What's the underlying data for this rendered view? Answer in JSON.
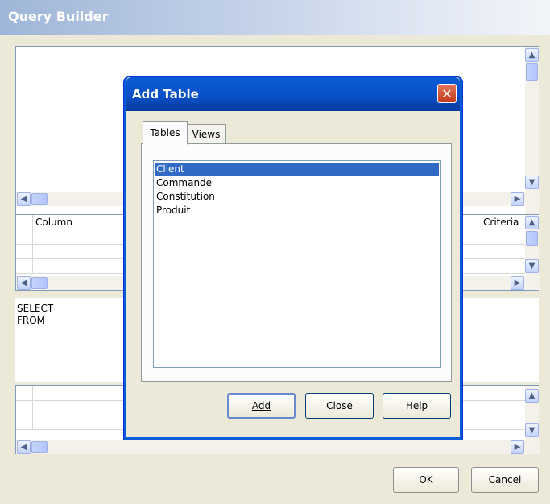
{
  "window": {
    "title": "Query Builder"
  },
  "grid": {
    "column_header": "Column",
    "criteria_header": "Criteria"
  },
  "sql": {
    "lines": [
      "SELECT",
      "FROM"
    ]
  },
  "footer": {
    "ok_label": "OK",
    "cancel_label": "Cancel"
  },
  "dialog": {
    "title": "Add Table",
    "tabs": [
      {
        "label": "Tables",
        "active": true
      },
      {
        "label": "Views",
        "active": false
      }
    ],
    "tables": [
      "Client",
      "Commande",
      "Constitution",
      "Produit"
    ],
    "selected_table": "Client",
    "buttons": {
      "add": "Add",
      "close": "Close",
      "help": "Help"
    }
  },
  "colors": {
    "selection": "#316ac5",
    "dialog_titlebar": "#0a5cd6",
    "close_button": "#c33b18"
  }
}
